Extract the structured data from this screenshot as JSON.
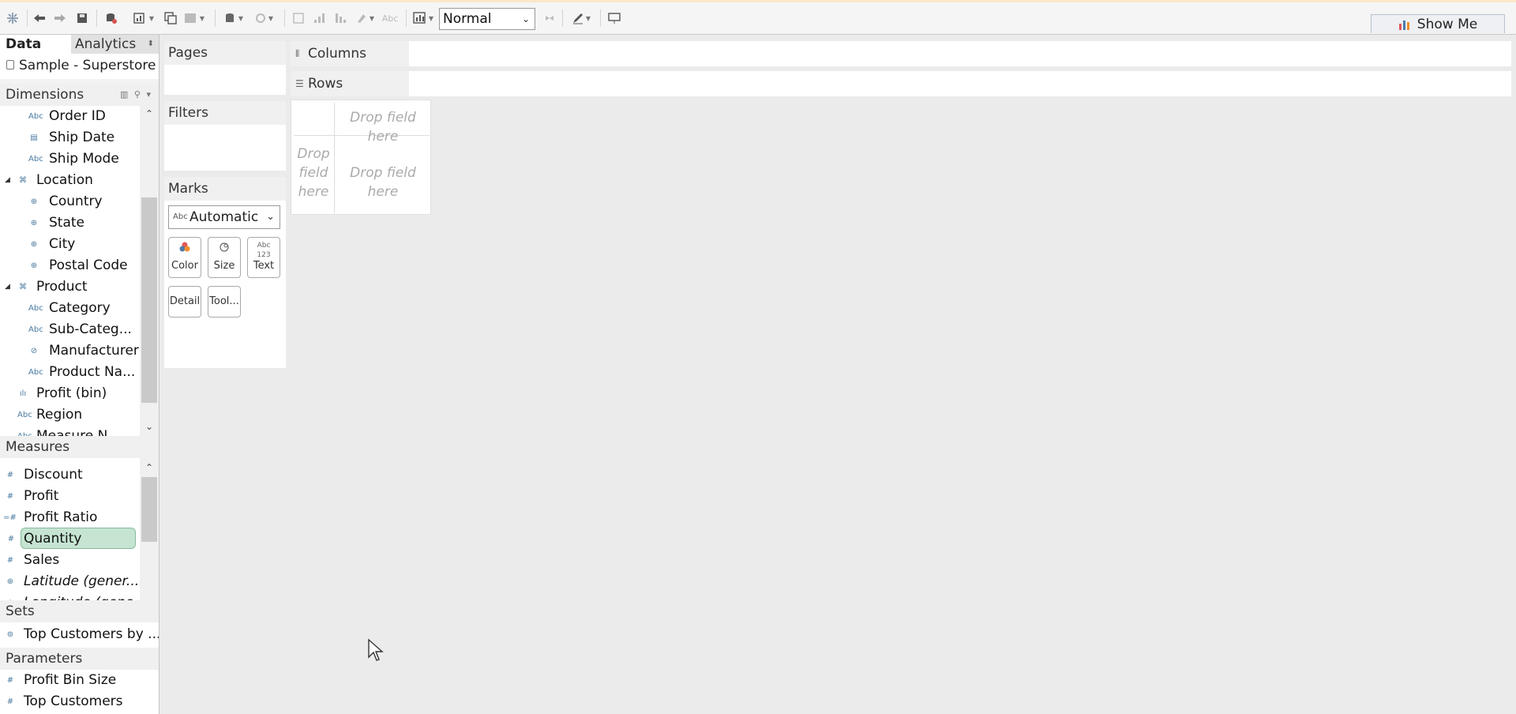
{
  "toolbar": {
    "fit_value": "Normal",
    "show_me_label": "Show Me",
    "icons": [
      "tableau-logo-icon",
      "undo-icon",
      "redo-icon",
      "save-icon",
      "new-datasource-icon",
      "new-worksheet-icon",
      "duplicate-icon",
      "clear-icon",
      "pause-updates-icon",
      "refresh-icon",
      "swap-icon",
      "sort-asc-icon",
      "sort-desc-icon",
      "highlight-icon",
      "labels-icon",
      "totals-icon",
      "fix-axes-icon",
      "pen-icon",
      "presentation-icon"
    ]
  },
  "left": {
    "tab_data": "Data",
    "tab_analytics": "Analytics",
    "datasource": "Sample - Superstore",
    "dimensions_header": "Dimensions",
    "dimensions": [
      {
        "label": "Order ID",
        "icon": "Abc"
      },
      {
        "label": "Ship Date",
        "icon": "date"
      },
      {
        "label": "Ship Mode",
        "icon": "Abc"
      },
      {
        "label": "Location",
        "icon": "hier"
      },
      {
        "label": "Country",
        "icon": "globe"
      },
      {
        "label": "State",
        "icon": "globe"
      },
      {
        "label": "City",
        "icon": "globe"
      },
      {
        "label": "Postal Code",
        "icon": "globe"
      },
      {
        "label": "Product",
        "icon": "hier"
      },
      {
        "label": "Category",
        "icon": "Abc"
      },
      {
        "label": "Sub-Categ...",
        "icon": "Abc"
      },
      {
        "label": "Manufacturer",
        "icon": "clip"
      },
      {
        "label": "Product Na...",
        "icon": "Abc"
      },
      {
        "label": "Profit (bin)",
        "icon": "bin"
      },
      {
        "label": "Region",
        "icon": "Abc"
      },
      {
        "label": "Measure N...",
        "icon": "Abc"
      }
    ],
    "measures_header": "Measures",
    "measures": [
      {
        "label": "Discount",
        "icon": "#"
      },
      {
        "label": "Profit",
        "icon": "#"
      },
      {
        "label": "Profit Ratio",
        "icon": "=#"
      },
      {
        "label": "Quantity",
        "icon": "#"
      },
      {
        "label": "Sales",
        "icon": "#"
      },
      {
        "label": "Latitude (gener...",
        "icon": "globe"
      },
      {
        "label": "Longitude (gene...",
        "icon": "globe"
      }
    ],
    "sets_header": "Sets",
    "sets": [
      {
        "label": "Top Customers by ..."
      }
    ],
    "parameters_header": "Parameters",
    "parameters": [
      {
        "label": "Profit Bin Size"
      },
      {
        "label": "Top Customers"
      }
    ]
  },
  "shelves": {
    "pages": "Pages",
    "filters": "Filters",
    "marks": "Marks",
    "mark_type": "Automatic",
    "mark_buttons": {
      "color": "Color",
      "size": "Size",
      "text": "Text",
      "detail": "Detail",
      "tooltip": "Tool..."
    },
    "columns": "Columns",
    "rows": "Rows"
  },
  "canvas": {
    "drop_top": "Drop field here",
    "drop_left": "Drop field here",
    "drop_center": "Drop field here"
  }
}
